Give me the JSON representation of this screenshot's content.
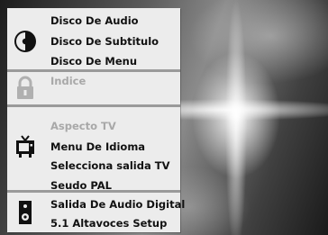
{
  "menu": {
    "groups": [
      {
        "icon": "disc-icon",
        "items": [
          {
            "label": "Disco De Audio",
            "enabled": true
          },
          {
            "label": "Disco De Subtitulo",
            "enabled": true
          },
          {
            "label": "Disco De Menu",
            "enabled": true
          }
        ]
      },
      {
        "icon": "lock-icon",
        "items": [
          {
            "label": "Indice",
            "enabled": false
          }
        ]
      },
      {
        "icon": "tv-icon",
        "items": [
          {
            "label": "Aspecto TV",
            "enabled": false
          },
          {
            "label": "Menu De Idioma",
            "enabled": true
          },
          {
            "label": "Selecciona salida TV",
            "enabled": true
          },
          {
            "label": "Seudo PAL",
            "enabled": true
          }
        ]
      },
      {
        "icon": "speaker-icon",
        "items": [
          {
            "label": "Salida De Audio Digital",
            "enabled": true
          },
          {
            "label": "5.1 Altavoces Setup",
            "enabled": true
          }
        ]
      }
    ]
  }
}
